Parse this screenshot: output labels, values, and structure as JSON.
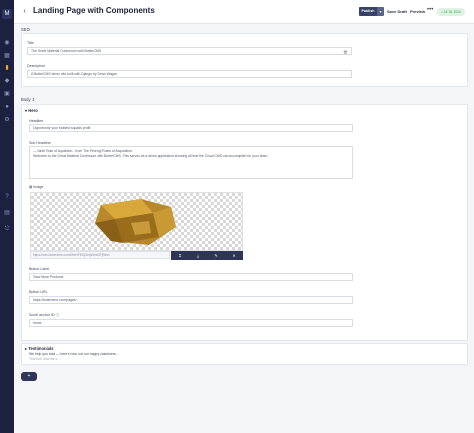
{
  "header": {
    "title": "Landing Page with Components",
    "publish_label": "Publish",
    "save_draft_label": "Save Draft",
    "preview_label": "Preview",
    "more_label": "•••",
    "status": "• Jul 18, 2024"
  },
  "sidebar": {
    "logo": "M",
    "icons": [
      "dashboard-icon",
      "grid-icon",
      "pages-icon",
      "components-icon",
      "media-icon",
      "users-icon",
      "settings-icon",
      "help-icon",
      "docs-icon",
      "logout-icon"
    ]
  },
  "seo": {
    "section_label": "SEO",
    "title_label": "Title",
    "title_value": "The Great Material Continuum with ButterCMS",
    "description_label": "Description",
    "description_value": "A ButterCMS demo site built with Django by Dean Wagon"
  },
  "body": {
    "section_label": "Body",
    "menu": {
      "title": "Hero",
      "headline_label": "Headline",
      "headline_value": "Opportunity your biddest squads profit",
      "subheadline_label": "Sub Headline",
      "subheadline_lines": [
        "— Ninth Rule of Aquisition - from The Ferengi Rules of Acquisition.",
        "Welcome to the Great Material Continuum with ButterCMS. This serves as a demo application showing all that the Cloud CMS can accomplish for your team."
      ],
      "image_label": "Image",
      "image_url": "https://cdn.buttercms.com/MieHFEtQScfjz5hbGFjRsvx",
      "toolbar_icons": [
        "crop-icon",
        "download-icon",
        "edit-icon",
        "remove-icon"
      ],
      "button_label_label": "Button Label",
      "button_label_value": "View More Products",
      "button_url_label": "Button URL",
      "button_url_value": "https://buttercms.com/pages/",
      "scroll_anchor_label": "Scroll anchor ID",
      "scroll_anchor_value": "home"
    },
    "testimonials": {
      "title": "Testimonials",
      "line1": "We help you hold — here's how, not our happy customers…",
      "line2": "This isn't how we c…"
    }
  },
  "add_button_label": "+"
}
